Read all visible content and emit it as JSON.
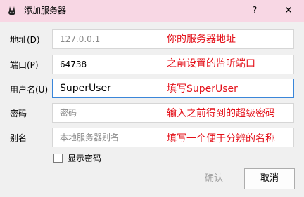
{
  "window": {
    "title": "添加服务器",
    "help_label": "?",
    "close_label": "✕",
    "icon": "rabbit-app-icon"
  },
  "form": {
    "address": {
      "label": "地址(D)",
      "value": "127.0.0.1"
    },
    "port": {
      "label": "端口(P)",
      "value": "64738"
    },
    "username": {
      "label": "用户名(U)",
      "value": "SuperUser"
    },
    "password": {
      "label": "密码",
      "placeholder": "密码"
    },
    "alias": {
      "label": "别名",
      "placeholder": "本地服务器别名"
    },
    "show_password": {
      "label": "显示密码",
      "checked": false
    }
  },
  "annotations": {
    "address": "你的服务器地址",
    "port": "之前设置的监听端口",
    "username": "填写SuperUser",
    "password": "输入之前得到的超级密码",
    "alias": "填写一个便于分辨的名称"
  },
  "buttons": {
    "ok": "确认",
    "cancel": "取消"
  },
  "colors": {
    "titlebar": "#f8d7e4",
    "annotation": "#e4111a",
    "focus_border": "#3a86d9"
  }
}
